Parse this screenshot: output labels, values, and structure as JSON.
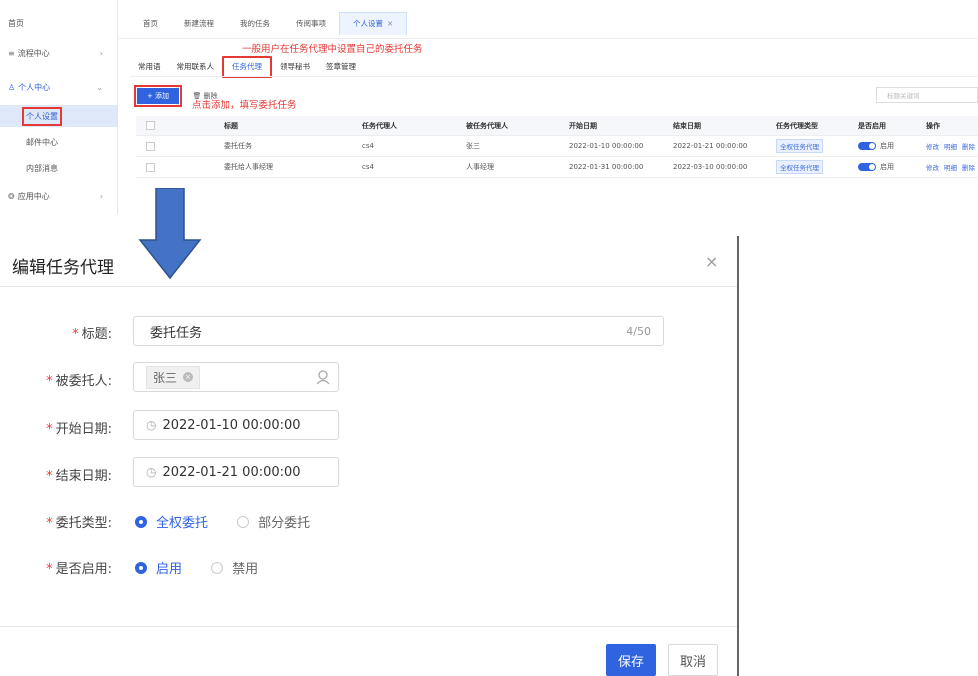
{
  "sidebar": {
    "items": [
      {
        "label": "首页",
        "icon": "home-icon"
      },
      {
        "label": "流程中心",
        "icon": "flow-icon"
      },
      {
        "label": "个人中心",
        "icon": "user-icon"
      },
      {
        "label": "个人设置",
        "icon": ""
      },
      {
        "label": "邮件中心",
        "icon": ""
      },
      {
        "label": "内部消息",
        "icon": ""
      },
      {
        "label": "应用中心",
        "icon": "app-icon"
      }
    ]
  },
  "topbar": {
    "tabs": [
      "首页",
      "新建流程",
      "我的任务",
      "传阅事项",
      "个人设置"
    ],
    "close_glyph": "×"
  },
  "subtabs": [
    "常用语",
    "常用联系人",
    "任务代理",
    "领导秘书",
    "签章管理"
  ],
  "annotations": {
    "note1": "一般用户在任务代理中设置自己的委托任务",
    "note2": "点击添加，填写委托任务"
  },
  "toolbar": {
    "add_label": "+ 添加",
    "delete_label": "🗑 删除",
    "search_placeholder": "标题关键词"
  },
  "table": {
    "headers": [
      "标题",
      "任务代理人",
      "被任务代理人",
      "开始日期",
      "结束日期",
      "任务代理类型",
      "是否启用",
      "操作"
    ],
    "rows": [
      {
        "title": "委托任务",
        "agent": "cs4",
        "delegator": "张三",
        "start": "2022-01-10 00:00:00",
        "end": "2022-01-21 00:00:00",
        "type": "全权任务代理",
        "enabled": "启用",
        "ops": [
          "修改",
          "明细",
          "删除"
        ]
      },
      {
        "title": "委托给人事经理",
        "agent": "cs4",
        "delegator": "人事经理",
        "start": "2022-01-31 00:00:00",
        "end": "2022-03-10 00:00:00",
        "type": "全权任务代理",
        "enabled": "启用",
        "ops": [
          "修改",
          "明细",
          "删除"
        ]
      }
    ]
  },
  "dialog": {
    "title": "编辑任务代理",
    "close_glyph": "×",
    "fields": {
      "title": {
        "label": "标题:",
        "value": "委托任务",
        "counter": "4/50"
      },
      "delegate": {
        "label": "被委托人:",
        "chip": "张三"
      },
      "start": {
        "label": "开始日期:",
        "value": "2022-01-10 00:00:00"
      },
      "end": {
        "label": "结束日期:",
        "value": "2022-01-21 00:00:00"
      },
      "type": {
        "label": "委托类型:",
        "options": [
          "全权委托",
          "部分委托"
        ],
        "selected": "全权委托"
      },
      "enabled": {
        "label": "是否启用:",
        "options": [
          "启用",
          "禁用"
        ],
        "selected": "启用"
      }
    },
    "required_mark": "*",
    "save_label": "保存",
    "cancel_label": "取消"
  },
  "colors": {
    "primary": "#2f63e0",
    "annotation": "#e53935",
    "arrow": "#4472c4"
  }
}
